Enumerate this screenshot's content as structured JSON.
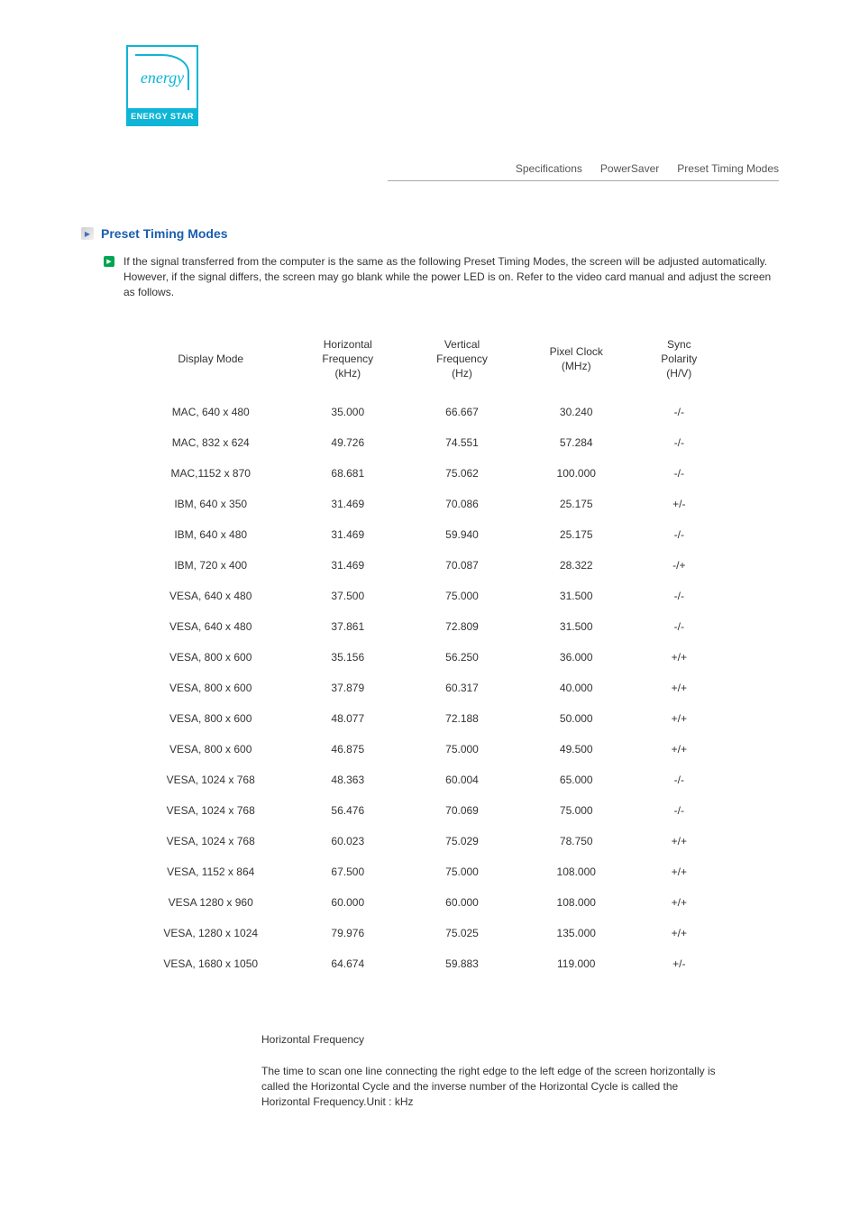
{
  "logo": {
    "script": "energy",
    "label": "ENERGY STAR"
  },
  "tabs": [
    {
      "label": "Specifications"
    },
    {
      "label": "PowerSaver"
    },
    {
      "label": "Preset Timing Modes"
    }
  ],
  "section": {
    "title": "Preset Timing Modes",
    "intro": "If the signal transferred from the computer is the same as the following Preset Timing Modes, the screen will be adjusted automatically. However, if the signal differs, the screen may go blank while the power LED is on. Refer to the video card manual and adjust the screen as follows."
  },
  "table": {
    "headers": [
      "Display Mode",
      "Horizontal Frequency (kHz)",
      "Vertical Frequency (Hz)",
      "Pixel Clock (MHz)",
      "Sync Polarity (H/V)"
    ],
    "rows": [
      [
        "MAC, 640 x 480",
        "35.000",
        "66.667",
        "30.240",
        "-/-"
      ],
      [
        "MAC, 832 x 624",
        "49.726",
        "74.551",
        "57.284",
        "-/-"
      ],
      [
        "MAC,1152 x 870",
        "68.681",
        "75.062",
        "100.000",
        "-/-"
      ],
      [
        "IBM, 640 x 350",
        "31.469",
        "70.086",
        "25.175",
        "+/-"
      ],
      [
        "IBM, 640 x 480",
        "31.469",
        "59.940",
        "25.175",
        "-/-"
      ],
      [
        "IBM, 720 x 400",
        "31.469",
        "70.087",
        "28.322",
        "-/+"
      ],
      [
        "VESA, 640 x 480",
        "37.500",
        "75.000",
        "31.500",
        "-/-"
      ],
      [
        "VESA, 640 x 480",
        "37.861",
        "72.809",
        "31.500",
        "-/-"
      ],
      [
        "VESA, 800 x 600",
        "35.156",
        "56.250",
        "36.000",
        "+/+"
      ],
      [
        "VESA, 800 x 600",
        "37.879",
        "60.317",
        "40.000",
        "+/+"
      ],
      [
        "VESA, 800 x 600",
        "48.077",
        "72.188",
        "50.000",
        "+/+"
      ],
      [
        "VESA, 800 x 600",
        "46.875",
        "75.000",
        "49.500",
        "+/+"
      ],
      [
        "VESA, 1024 x 768",
        "48.363",
        "60.004",
        "65.000",
        "-/-"
      ],
      [
        "VESA, 1024 x 768",
        "56.476",
        "70.069",
        "75.000",
        "-/-"
      ],
      [
        "VESA, 1024 x 768",
        "60.023",
        "75.029",
        "78.750",
        "+/+"
      ],
      [
        "VESA, 1152 x 864",
        "67.500",
        "75.000",
        "108.000",
        "+/+"
      ],
      [
        "VESA 1280 x 960",
        "60.000",
        "60.000",
        "108.000",
        "+/+"
      ],
      [
        "VESA, 1280 x 1024",
        "79.976",
        "75.025",
        "135.000",
        "+/+"
      ],
      [
        "VESA, 1680 x 1050",
        "64.674",
        "59.883",
        "119.000",
        "+/-"
      ]
    ]
  },
  "footer": {
    "title": "Horizontal Frequency",
    "text": "The time to scan one line connecting the right edge to the left edge of the screen horizontally is called the Horizontal Cycle and the inverse number of the Horizontal Cycle is called the Horizontal Frequency.Unit : kHz"
  }
}
